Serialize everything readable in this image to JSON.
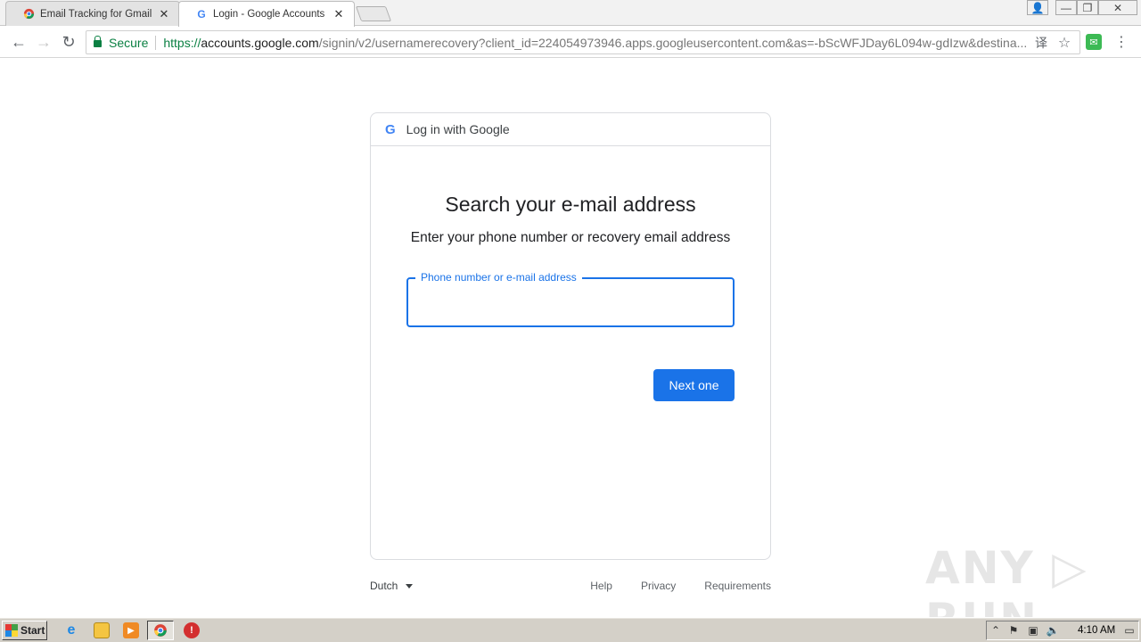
{
  "browser": {
    "tabs": [
      {
        "title": "Email Tracking for Gmail - Ma",
        "favicon": "chrome-store-icon",
        "active": false
      },
      {
        "title": "Login - Google Accounts",
        "favicon": "google-g-icon",
        "active": true
      }
    ],
    "window_controls": {
      "user": "👤",
      "minimize": "—",
      "restore": "❐",
      "close": "✕"
    },
    "nav": {
      "back": "←",
      "forward": "→",
      "reload": "↻"
    },
    "security_label": "Secure",
    "url": {
      "scheme": "https://",
      "host": "accounts.google.com",
      "path": "/signin/v2/usernamerecovery?client_id=224054973946.apps.googleusercontent.com&as=-bScWFJDay6L094w-gdIzw&destina..."
    },
    "omni_icons": {
      "translate": "译",
      "star": "☆"
    },
    "extension_label": "✉",
    "menu": "⋮"
  },
  "card": {
    "header_logo": "G",
    "header_text": "Log in with Google",
    "heading": "Search your e-mail address",
    "subheading": "Enter your phone number or recovery email address",
    "field_label": "Phone number or e-mail address",
    "field_value": "",
    "next_button": "Next one"
  },
  "footer": {
    "language": "Dutch",
    "links": [
      "Help",
      "Privacy",
      "Requirements"
    ]
  },
  "watermark": "ANY ▷ RUN",
  "taskbar": {
    "start_label": "Start",
    "icons": [
      "ie-icon",
      "folder-icon",
      "media-player-icon",
      "chrome-icon",
      "opera-icon"
    ],
    "tray_glyphs": [
      "⌃",
      "⚑",
      "▣",
      "🔈",
      "▭"
    ],
    "clock": "4:10 AM"
  }
}
